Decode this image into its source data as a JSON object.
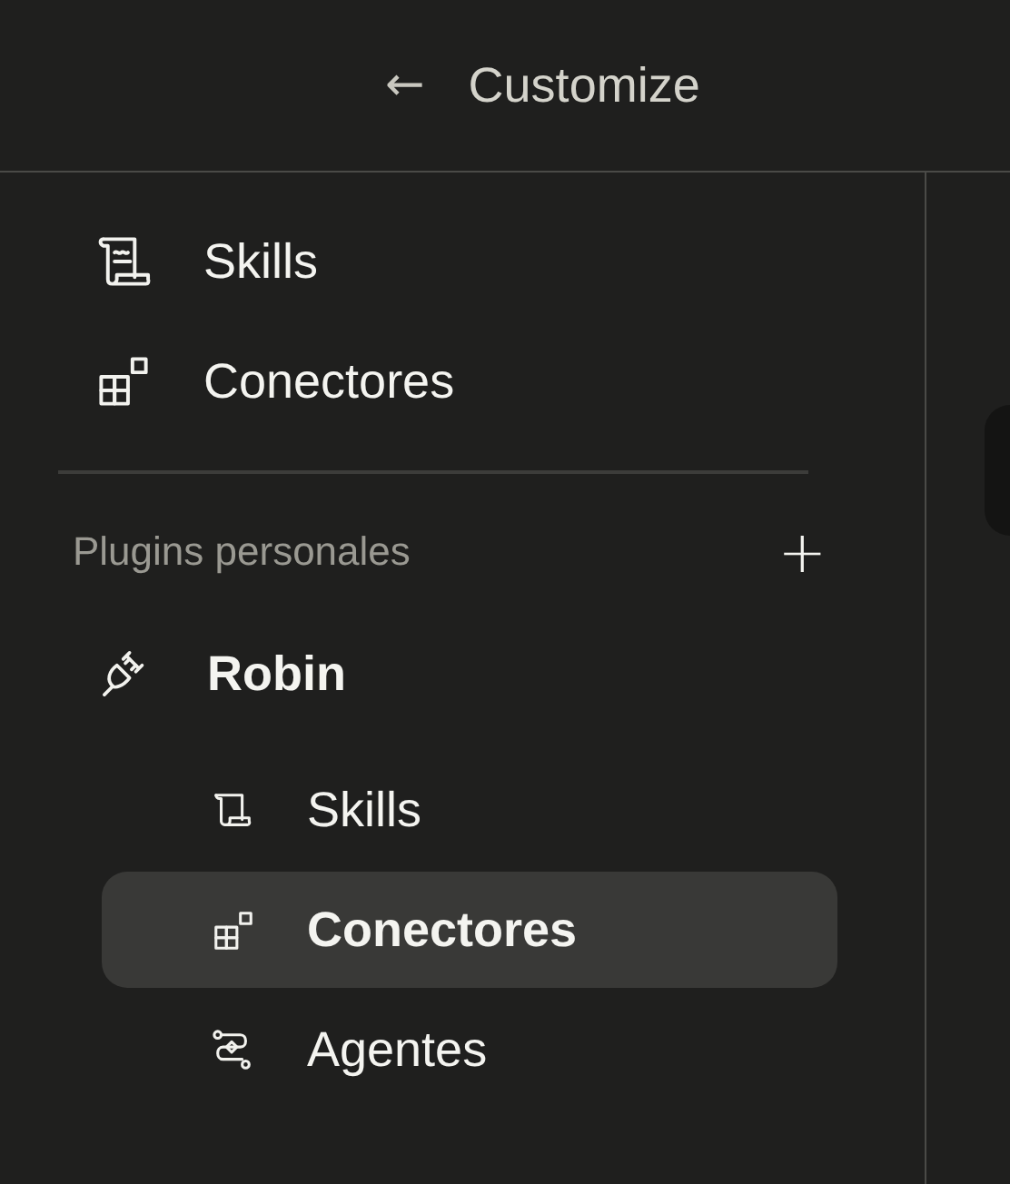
{
  "header": {
    "back": "←",
    "title": "Customize"
  },
  "nav": [
    {
      "label": "Skills",
      "selected": false
    },
    {
      "label": "Conectores",
      "selected": false
    }
  ],
  "plugins_section": {
    "title": "Plugins personales",
    "add": "+",
    "plugins": [
      {
        "name": "Robin",
        "children": [
          {
            "label": "Skills",
            "selected": false
          },
          {
            "label": "Conectores",
            "selected": true
          },
          {
            "label": "Agentes",
            "selected": false
          }
        ]
      }
    ]
  }
}
